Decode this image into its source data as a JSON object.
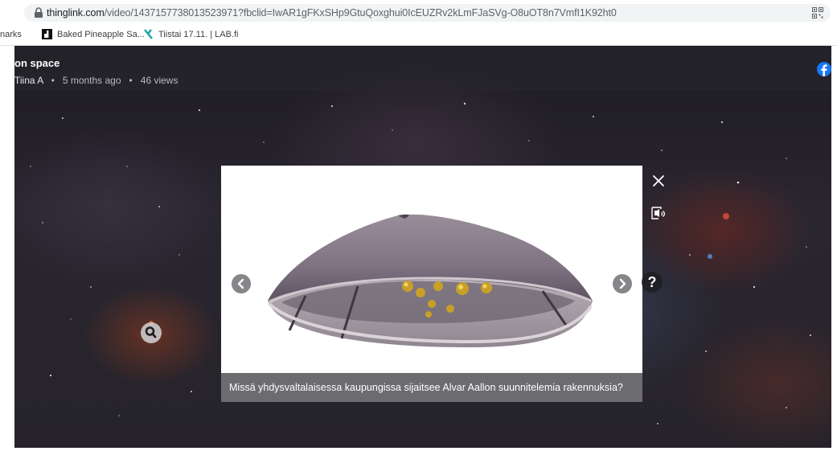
{
  "browser": {
    "url_host": "thinglink.com",
    "url_path": "/video/1437157738013523971?fbclid=IwAR1gFKxSHp9GtuQoxghui0IcEUZRv2kLmFJaSVg-O8uOT8n7VmfI1K92ht0"
  },
  "bookmarks": {
    "items": [
      {
        "label": "narks"
      },
      {
        "label": "Baked Pineapple Sa..."
      },
      {
        "label": "Tiistai 17.11. | LAB.fi"
      }
    ]
  },
  "video": {
    "title": "on space",
    "author": "Tiina A",
    "meta_sep": "•",
    "posted": "5 months ago",
    "views": "46 views"
  },
  "modal": {
    "caption": "Missä yhdysvaltalaisessa kaupungissa sijaitsee Alvar Aallon suunnitelemia rakennuksia?",
    "help_label": "?"
  },
  "colors": {
    "facebook": "#1877f2",
    "caption_bg": "#5f5f64"
  }
}
